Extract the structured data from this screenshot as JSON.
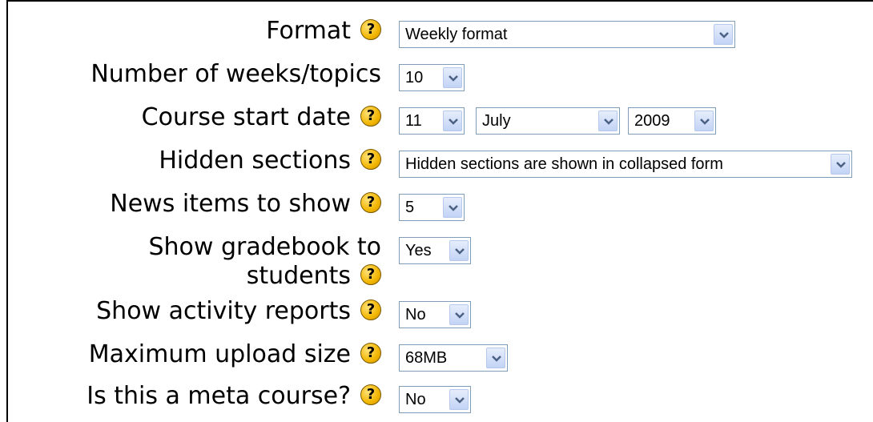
{
  "form": {
    "rows": [
      {
        "label": "Format",
        "value": "Weekly format"
      },
      {
        "label": "Number of weeks/topics",
        "value": "10"
      },
      {
        "label": "Course start date",
        "day": "11",
        "month": "July",
        "year": "2009"
      },
      {
        "label": "Hidden sections",
        "value": "Hidden sections are shown in collapsed form"
      },
      {
        "label": "News items to show",
        "value": "5"
      },
      {
        "label_line1": "Show gradebook to",
        "label_line2": "students",
        "value": "Yes"
      },
      {
        "label": "Show activity reports",
        "value": "No"
      },
      {
        "label": "Maximum upload size",
        "value": "68MB"
      },
      {
        "label": "Is this a meta course?",
        "value": "No"
      }
    ],
    "help_glyph": "?"
  },
  "icons": {
    "help": "help-icon",
    "dropdown": "chevron-down-icon"
  },
  "colors": {
    "help_icon": "#f2b600",
    "select_border": "#7f9db9",
    "arrow_bg": "#c2d3f5"
  }
}
